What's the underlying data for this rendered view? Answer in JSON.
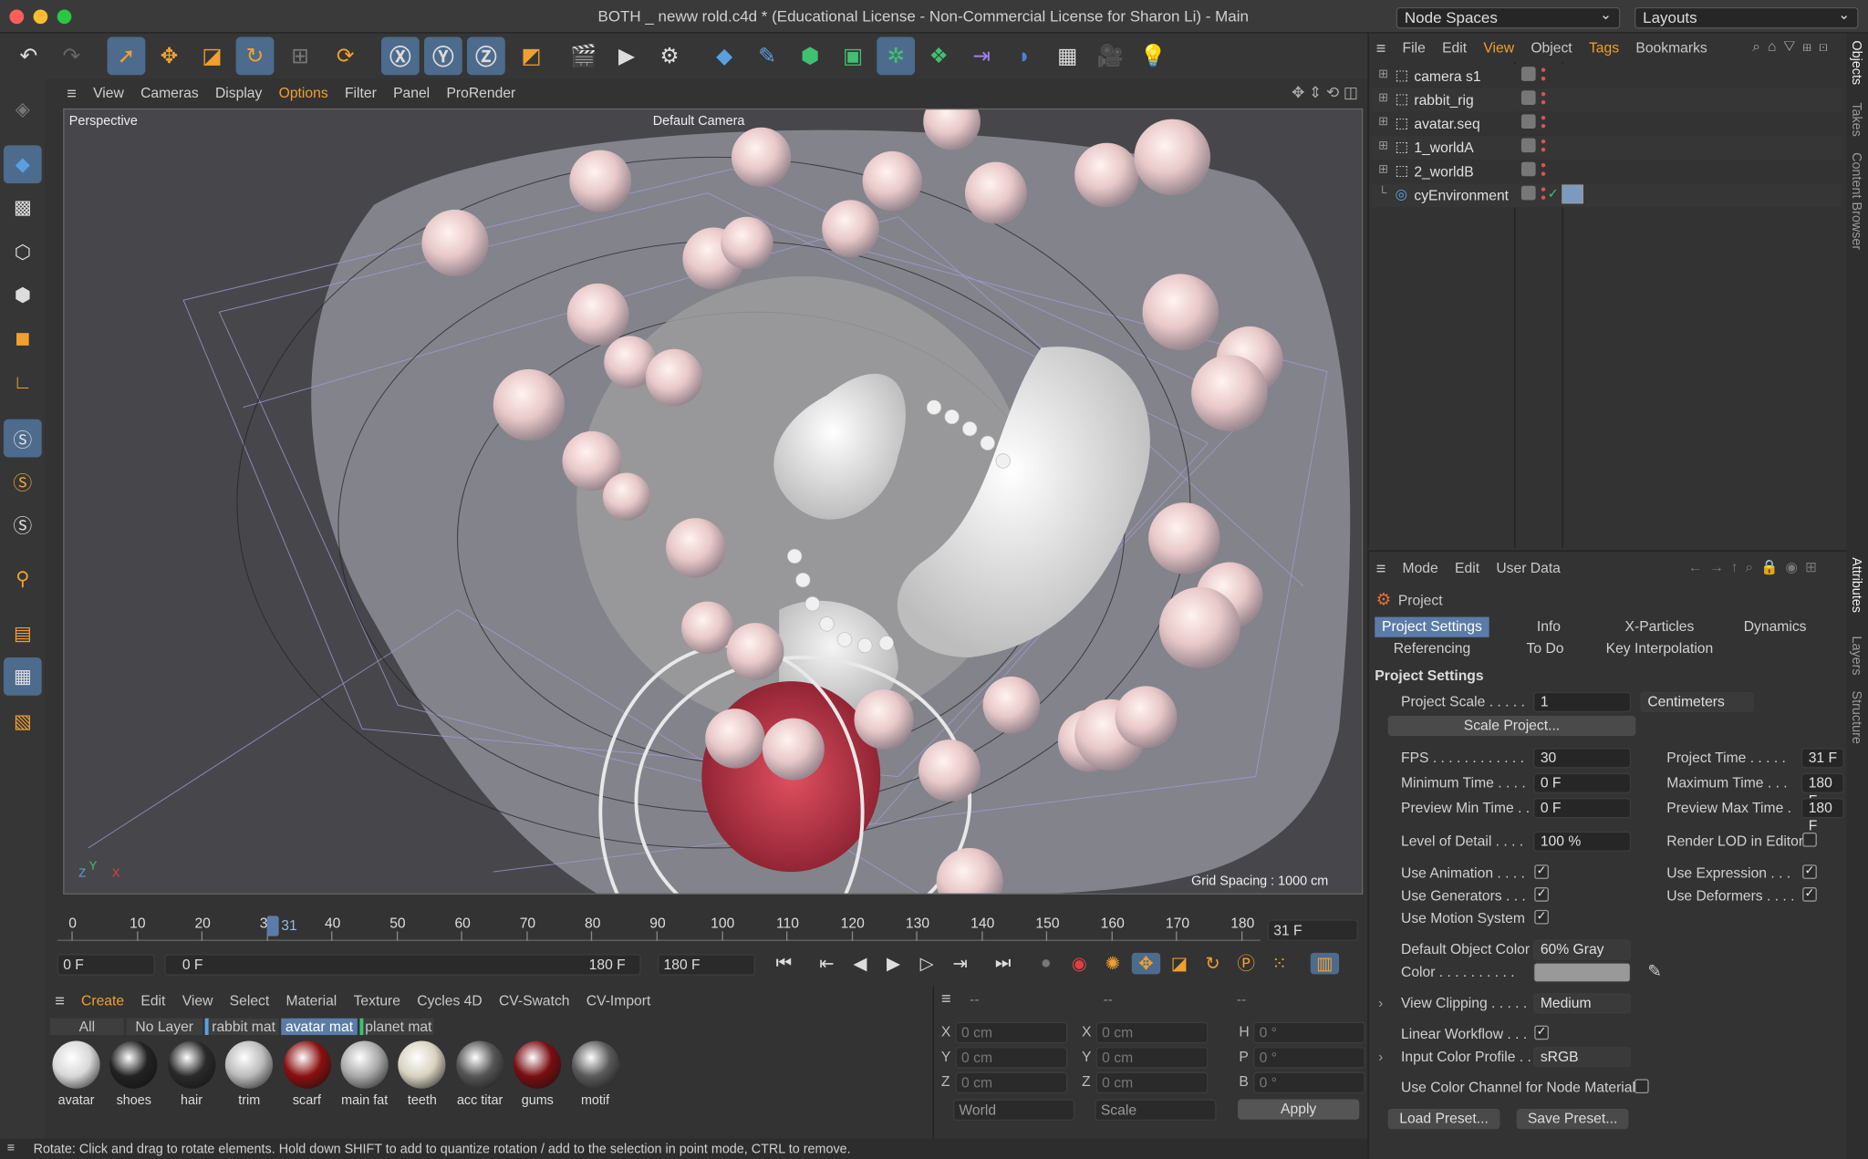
{
  "window": {
    "title": "BOTH _ neww rold.c4d * (Educational License - Non-Commercial License for Sharon Li) - Main",
    "node_spaces": "Node Spaces",
    "layouts": "Layouts"
  },
  "viewport": {
    "menu": [
      "View",
      "Cameras",
      "Display",
      "Options",
      "Filter",
      "Panel",
      "ProRender"
    ],
    "label": "Perspective",
    "camera": "Default Camera",
    "grid_spacing": "Grid Spacing : 1000 cm",
    "axes": {
      "z": "Z",
      "y": "Y",
      "x": "X"
    }
  },
  "timeline": {
    "ticks": [
      "0",
      "10",
      "20",
      "30",
      "40",
      "50",
      "60",
      "70",
      "80",
      "90",
      "100",
      "110",
      "120",
      "130",
      "140",
      "150",
      "160",
      "170",
      "180"
    ],
    "current_marker": "31",
    "current_frame": "31 F",
    "start_field": "0 F",
    "range_start": "0 F",
    "range_end": "180 F",
    "end_field": "180 F"
  },
  "material_manager": {
    "menu": [
      "Create",
      "Edit",
      "View",
      "Select",
      "Material",
      "Texture",
      "Cycles 4D",
      "CV-Swatch",
      "CV-Import"
    ],
    "filters": [
      "All",
      "No Layer",
      "rabbit mat",
      "avatar mat",
      "planet mat"
    ],
    "materials": [
      {
        "name": "avatar",
        "color": "#d8d8d8"
      },
      {
        "name": "shoes",
        "color": "#222222"
      },
      {
        "name": "hair",
        "color": "#2a2a2a"
      },
      {
        "name": "trim",
        "color": "#bbbbbb"
      },
      {
        "name": "scarf",
        "color": "#8a1010"
      },
      {
        "name": "main fat",
        "color": "#aaaaaa"
      },
      {
        "name": "teeth",
        "color": "#d8d2c0"
      },
      {
        "name": "acc titar",
        "color": "#555555"
      },
      {
        "name": "gums",
        "color": "#7a0e12"
      },
      {
        "name": "motif",
        "color": "#5a5a5a"
      }
    ]
  },
  "coords": {
    "headers": [
      "--",
      "--",
      "--"
    ],
    "pos_labels": [
      "X",
      "Y",
      "Z"
    ],
    "size_labels": [
      "X",
      "Y",
      "Z"
    ],
    "rot_labels": [
      "H",
      "P",
      "B"
    ],
    "pos_values": [
      "0 cm",
      "0 cm",
      "0 cm"
    ],
    "size_values": [
      "0 cm",
      "0 cm",
      "0 cm"
    ],
    "rot_values": [
      "0 °",
      "0 °",
      "0 °"
    ],
    "world": "World",
    "scale": "Scale",
    "apply": "Apply"
  },
  "status": "Rotate: Click and drag to rotate elements. Hold down SHIFT to add to quantize rotation / add to the selection in point mode, CTRL to remove.",
  "object_manager": {
    "menu": [
      "File",
      "Edit",
      "View",
      "Object",
      "Tags",
      "Bookmarks"
    ],
    "objects": [
      "camera s1",
      "rabbit_rig",
      "avatar.seq",
      "1_worldA",
      "2_worldB",
      "cyEnvironment"
    ]
  },
  "attributes": {
    "menu": [
      "Mode",
      "Edit",
      "User Data"
    ],
    "header": "Project",
    "tabs_row1": [
      "Project Settings",
      "Info",
      "X-Particles",
      "Dynamics"
    ],
    "tabs_row2": [
      "Referencing",
      "To Do",
      "Key Interpolation"
    ],
    "section": "Project Settings",
    "project_scale_label": "Project Scale . . . . .",
    "project_scale_value": "1",
    "project_scale_unit": "Centimeters",
    "scale_project_btn": "Scale Project...",
    "fps_label": "FPS . . . . . . . . . . . .",
    "fps_value": "30",
    "project_time_label": "Project Time . . . . .",
    "project_time_value": "31 F",
    "min_time_label": "Minimum Time . . . .",
    "min_time_value": "0 F",
    "max_time_label": "Maximum Time . . .",
    "max_time_value": "180 F",
    "prev_min_label": "Preview Min Time . .",
    "prev_min_value": "0 F",
    "prev_max_label": "Preview Max Time .",
    "prev_max_value": "180 F",
    "lod_label": "Level of Detail . . . .",
    "lod_value": "100 %",
    "render_lod_label": "Render LOD in Editor",
    "use_animation_label": "Use Animation . . . .",
    "use_expression_label": "Use Expression . . .",
    "use_generators_label": "Use Generators . . .",
    "use_deformers_label": "Use Deformers . . . .",
    "use_motion_label": "Use Motion System",
    "default_color_label": "Default Object Color",
    "default_color_value": "60% Gray",
    "color_label": "Color . . . . . . . . . .",
    "view_clipping_label": "View Clipping . . . . .",
    "view_clipping_value": "Medium",
    "linear_workflow_label": "Linear Workflow . . .",
    "input_color_label": "Input Color Profile . .",
    "input_color_value": "sRGB",
    "color_channel_label": "Use Color Channel for Node Material",
    "load_preset": "Load Preset...",
    "save_preset": "Save Preset..."
  },
  "side_tabs": [
    "Objects",
    "Takes",
    "Content Browser",
    "Attributes",
    "Layers",
    "Structure"
  ]
}
